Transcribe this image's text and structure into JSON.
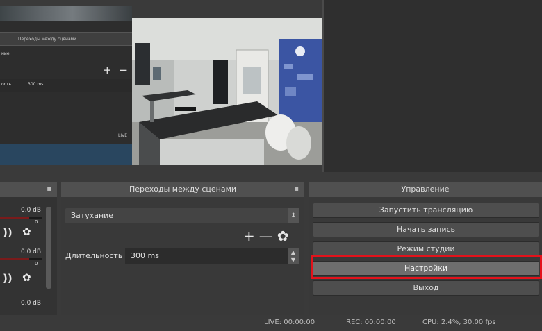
{
  "nested_preview": {
    "header_label": "Переходы между сценами",
    "sublabel": "ние",
    "duration_label": "ость",
    "duration_value": "300 ms",
    "live_label": "LIVE"
  },
  "mixer": {
    "channels": [
      {
        "level": "0.0 dB",
        "tick": "0"
      },
      {
        "level": "0.0 dB",
        "tick": "0"
      },
      {
        "level": "0.0 dB"
      }
    ],
    "speaker_glyph": "))",
    "gear_glyph": "✿"
  },
  "transitions": {
    "title": "Переходы между сценами",
    "selected": "Затухание",
    "duration_label": "Длительность",
    "duration_value": "300 ms",
    "add_glyph": "+",
    "remove_glyph": "—",
    "settings_glyph": "✿",
    "float_glyph": "▪"
  },
  "controls": {
    "title": "Управление",
    "buttons": [
      {
        "label": "Запустить трансляцию"
      },
      {
        "label": "Начать запись"
      },
      {
        "label": "Режим студии"
      },
      {
        "label": "Настройки"
      },
      {
        "label": "Выход"
      }
    ]
  },
  "status": {
    "live": "LIVE: 00:00:00",
    "rec": "REC: 00:00:00",
    "cpu": "CPU: 2.4%, 30.00 fps"
  },
  "colors": {
    "highlight": "#e3121b",
    "dark_panel": "#393939",
    "title_bar": "#505050"
  }
}
